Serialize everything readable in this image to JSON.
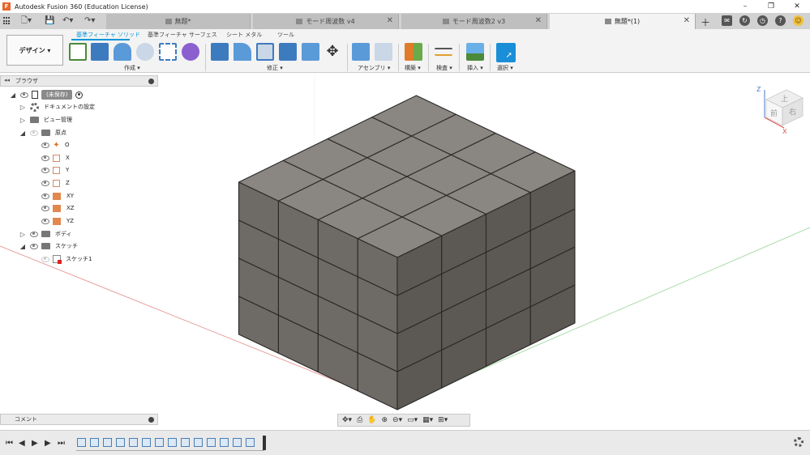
{
  "window": {
    "title": "Autodesk Fusion 360 (Education License)",
    "controls": [
      "–",
      "❐",
      "✕"
    ]
  },
  "tabs": [
    {
      "label": "無題*",
      "active": false
    },
    {
      "label": "モード周波数 v4",
      "active": false
    },
    {
      "label": "モード周波数2 v3",
      "active": false
    },
    {
      "label": "無題*(1)",
      "active": true
    }
  ],
  "toolbar": {
    "workspace_button": "デザイン ▾",
    "workspace_tabs": [
      "基準フィーチャ ソリッド",
      "基準フィーチャ サーフェス",
      "シート メタル",
      "ツール"
    ],
    "groups": [
      "作成 ▾",
      "修正 ▾",
      "アセンブリ ▾",
      "構築 ▾",
      "検査 ▾",
      "挿入 ▾",
      "選択 ▾"
    ]
  },
  "browser": {
    "title": "ブラウザ",
    "root_label": "(未保存)",
    "items": [
      {
        "label": "ドキュメントの設定"
      },
      {
        "label": "ビュー管理"
      },
      {
        "label": "原点"
      },
      {
        "label": "O"
      },
      {
        "label": "X"
      },
      {
        "label": "Y"
      },
      {
        "label": "Z"
      },
      {
        "label": "XY"
      },
      {
        "label": "XZ"
      },
      {
        "label": "YZ"
      },
      {
        "label": "ボディ"
      },
      {
        "label": "スケッチ"
      },
      {
        "label": "スケッチ1"
      }
    ]
  },
  "comments": {
    "label": "コメント"
  },
  "viewcube": {
    "top": "上",
    "front": "前",
    "right": "右",
    "axis_z": "Z",
    "axis_x": "X"
  },
  "colors": {
    "accent": "#0696d7",
    "block_face": "#6e6a65",
    "block_top": "#8a8681",
    "block_side": "#5c5955"
  }
}
